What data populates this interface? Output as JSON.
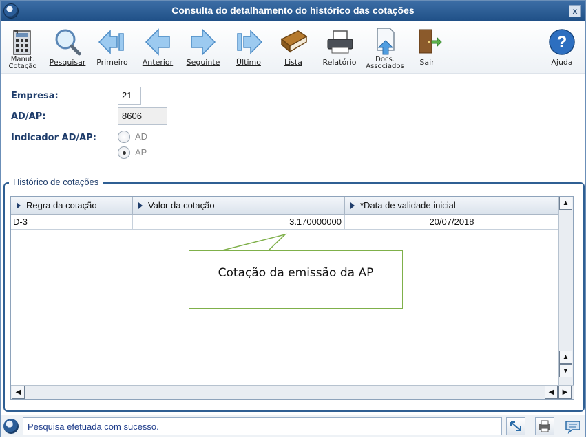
{
  "window": {
    "title": "Consulta do detalhamento do histórico das cotações",
    "close_label": "x"
  },
  "toolbar": {
    "manut_line1": "Manut.",
    "manut_line2": "Cotação",
    "pesquisar": "Pesquisar",
    "primeiro": "Primeiro",
    "anterior": "Anterior",
    "seguinte": "Seguinte",
    "ultimo": "Último",
    "lista": "Lista",
    "relatorio": "Relatório",
    "docs_line1": "Docs.",
    "docs_line2": "Associados",
    "sair": "Sair",
    "ajuda": "Ajuda",
    "help_glyph": "?"
  },
  "form": {
    "empresa_label": "Empresa:",
    "empresa_value": "21",
    "adap_label": "AD/AP:",
    "adap_value": "8606",
    "indicador_label": "Indicador AD/AP:",
    "radio_ad": "AD",
    "radio_ap": "AP",
    "selected": "AP"
  },
  "history": {
    "group_title": "Histórico de cotações",
    "columns": [
      "Regra da cotação",
      "Valor da cotação",
      "*Data de validade inicial"
    ],
    "rows": [
      [
        "D-3",
        "3.170000000",
        "20/07/2018"
      ]
    ]
  },
  "callout": {
    "text": "Cotação da emissão da AP"
  },
  "status": {
    "message": "Pesquisa efetuada com sucesso."
  },
  "colors": {
    "titlebar": "#1f4f86",
    "accent": "#2f5f93",
    "callout_border": "#7fb04a"
  }
}
